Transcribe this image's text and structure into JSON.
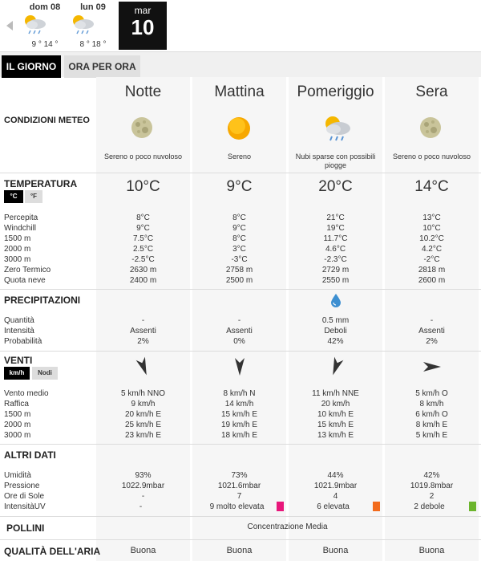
{
  "days": [
    {
      "label": "dom 08",
      "temps": "9 ° 14 °",
      "icon": "cloud-sun-rain-icon"
    },
    {
      "label": "lun 09",
      "temps": "8 ° 18 °",
      "icon": "cloud-sun-rain-icon"
    }
  ],
  "today": {
    "month": "mar",
    "day": "10"
  },
  "tabs": {
    "day": "IL GIORNO",
    "hourly": "ORA PER ORA"
  },
  "periods": [
    {
      "name": "Notte",
      "condition": "Sereno o poco nuvoloso",
      "icon": "moon-icon",
      "temp": "10°C",
      "percepita": "8°C",
      "windchill": "9°C",
      "t1500": "7.5°C",
      "t2000": "2.5°C",
      "t3000": "-2.5°C",
      "zero_termico": "2630 m",
      "quota_neve": "2400 m",
      "quantita": "-",
      "intensita": "Assenti",
      "probabilita": "2%",
      "wind_dir": "NNO",
      "vento_medio": "5 km/h  NNO",
      "raffica": "9 km/h",
      "w1500": "20 km/h E",
      "w2000": "25 km/h E",
      "w3000": "23 km/h E",
      "umidita": "93%",
      "pressione": "1022.9mbar",
      "ore_sole": "-",
      "uv": "-",
      "uv_color": "",
      "aria": "Buona"
    },
    {
      "name": "Mattina",
      "condition": "Sereno",
      "icon": "sun-icon",
      "temp": "9°C",
      "percepita": "8°C",
      "windchill": "9°C",
      "t1500": "8°C",
      "t2000": "3°C",
      "t3000": "-3°C",
      "zero_termico": "2758 m",
      "quota_neve": "2500 m",
      "quantita": "-",
      "intensita": "Assenti",
      "probabilita": "0%",
      "wind_dir": "N",
      "vento_medio": "8 km/h N",
      "raffica": "14 km/h",
      "w1500": "15 km/h E",
      "w2000": "19 km/h E",
      "w3000": "18 km/h E",
      "umidita": "73%",
      "pressione": "1021.6mbar",
      "ore_sole": "7",
      "uv": "9 molto elevata",
      "uv_color": "#e8177b",
      "aria": "Buona"
    },
    {
      "name": "Pomeriggio",
      "condition": "Nubi sparse con possibili piogge",
      "icon": "cloud-sun-rain-icon",
      "temp": "20°C",
      "percepita": "21°C",
      "windchill": "19°C",
      "t1500": "11.7°C",
      "t2000": "4.6°C",
      "t3000": "-2.3°C",
      "zero_termico": "2729 m",
      "quota_neve": "2550 m",
      "quantita": "0.5 mm",
      "intensita": "Deboli",
      "probabilita": "42%",
      "wind_dir": "NNE",
      "vento_medio": "11 km/h NNE",
      "raffica": "20 km/h",
      "w1500": "10 km/h E",
      "w2000": "15 km/h E",
      "w3000": "13 km/h E",
      "umidita": "44%",
      "pressione": "1021.9mbar",
      "ore_sole": "4",
      "uv": "6 elevata",
      "uv_color": "#f26b1d",
      "aria": "Buona"
    },
    {
      "name": "Sera",
      "condition": "Sereno o poco nuvoloso",
      "icon": "moon-icon",
      "temp": "14°C",
      "percepita": "13°C",
      "windchill": "10°C",
      "t1500": "10.2°C",
      "t2000": "4.2°C",
      "t3000": "-2°C",
      "zero_termico": "2818 m",
      "quota_neve": "2600 m",
      "quantita": "-",
      "intensita": "Assenti",
      "probabilita": "2%",
      "wind_dir": "O",
      "vento_medio": "5 km/h O",
      "raffica": "8 km/h",
      "w1500": "6 km/h O",
      "w2000": "8 km/h E",
      "w3000": "5 km/h E",
      "umidita": "42%",
      "pressione": "1019.8mbar",
      "ore_sole": "2",
      "uv": "2 debole",
      "uv_color": "#6cb52d",
      "aria": "Buona"
    }
  ],
  "sections": {
    "condizioni": "CONDIZIONI METEO",
    "temperatura": "TEMPERATURA",
    "precipitazioni": "PRECIPITAZIONI",
    "venti": "VENTI",
    "altri": "ALTRI DATI",
    "pollini": "POLLINI",
    "aria": "QUALITÀ DELL'ARIA"
  },
  "units": {
    "celsius": "°C",
    "fahrenheit": "°F",
    "kmh": "km/h",
    "knots": "Nodi"
  },
  "labels": {
    "percepita": "Percepita",
    "windchill": "Windchill",
    "h1500": "1500 m",
    "h2000": "2000 m",
    "h3000": "3000 m",
    "zero_termico": "Zero Termico",
    "quota_neve": "Quota neve",
    "quantita": "Quantità",
    "intensita": "Intensità",
    "probabilita": "Probabilità",
    "vento_medio": "Vento medio",
    "raffica": "Raffica",
    "umidita": "Umidità",
    "pressione": "Pressione",
    "ore_sole": "Ore di Sole",
    "uv": "IntensitàUV"
  },
  "pollini": "Concentrazione Media",
  "colors": {
    "active": "#000000",
    "column_bg": "#f6f6f6",
    "rain_drop": "#3d8fd1"
  }
}
